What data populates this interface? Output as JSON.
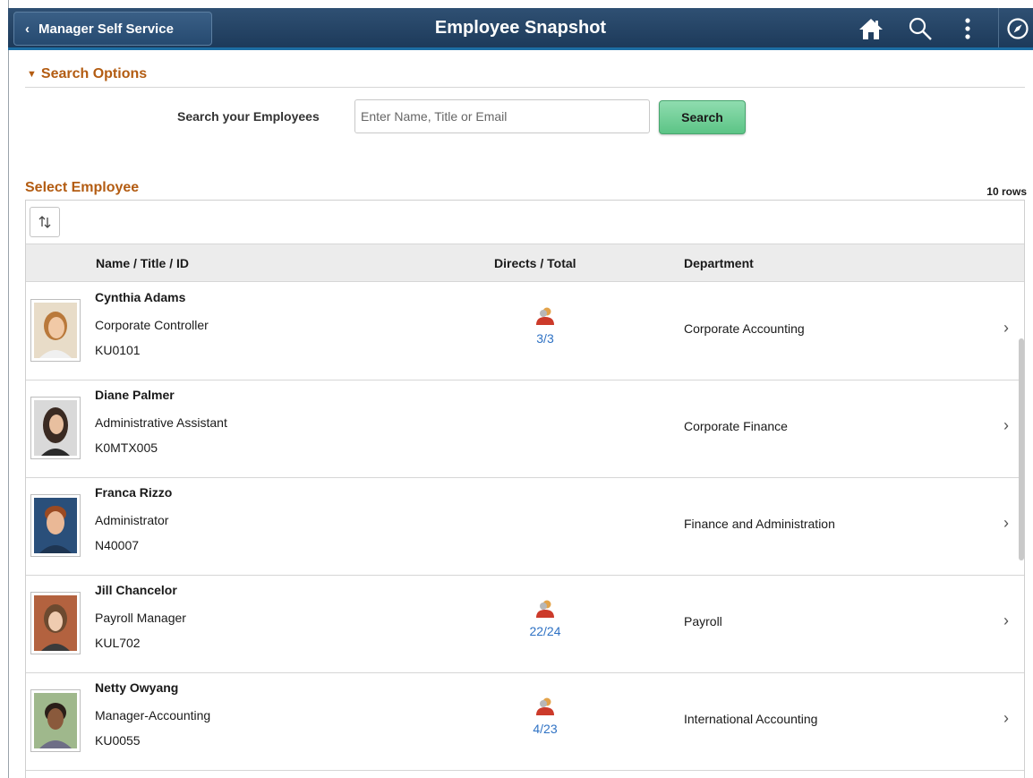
{
  "header": {
    "back_label": "Manager Self Service",
    "title": "Employee Snapshot",
    "icons": [
      "home-icon",
      "search-icon",
      "actions-menu-icon",
      "navbar-compass-icon"
    ]
  },
  "search": {
    "section_label": "Search Options",
    "field_label": "Search your Employees",
    "placeholder": "Enter Name, Title or Email",
    "value": "",
    "button_label": "Search"
  },
  "grid": {
    "title": "Select Employee",
    "row_count": "10 rows",
    "columns": {
      "name": "Name / Title / ID",
      "directs": "Directs / Total",
      "department": "Department"
    },
    "rows": [
      {
        "name": "Cynthia Adams",
        "title": "Corporate Controller",
        "id": "KU0101",
        "directs": "3/3",
        "department": "Corporate Accounting"
      },
      {
        "name": "Diane Palmer",
        "title": "Administrative Assistant",
        "id": "K0MTX005",
        "directs": "",
        "department": "Corporate Finance"
      },
      {
        "name": "Franca Rizzo",
        "title": "Administrator",
        "id": "N40007",
        "directs": "",
        "department": "Finance and Administration"
      },
      {
        "name": "Jill Chancelor",
        "title": "Payroll Manager",
        "id": "KUL702",
        "directs": "22/24",
        "department": "Payroll"
      },
      {
        "name": "Netty Owyang",
        "title": "Manager-Accounting",
        "id": "KU0055",
        "directs": "4/23",
        "department": "International Accounting"
      }
    ]
  },
  "colors": {
    "header_bg": "#264a70",
    "section_title": "#b35c12",
    "search_button": "#5cc486",
    "link_blue": "#2f72c4"
  }
}
